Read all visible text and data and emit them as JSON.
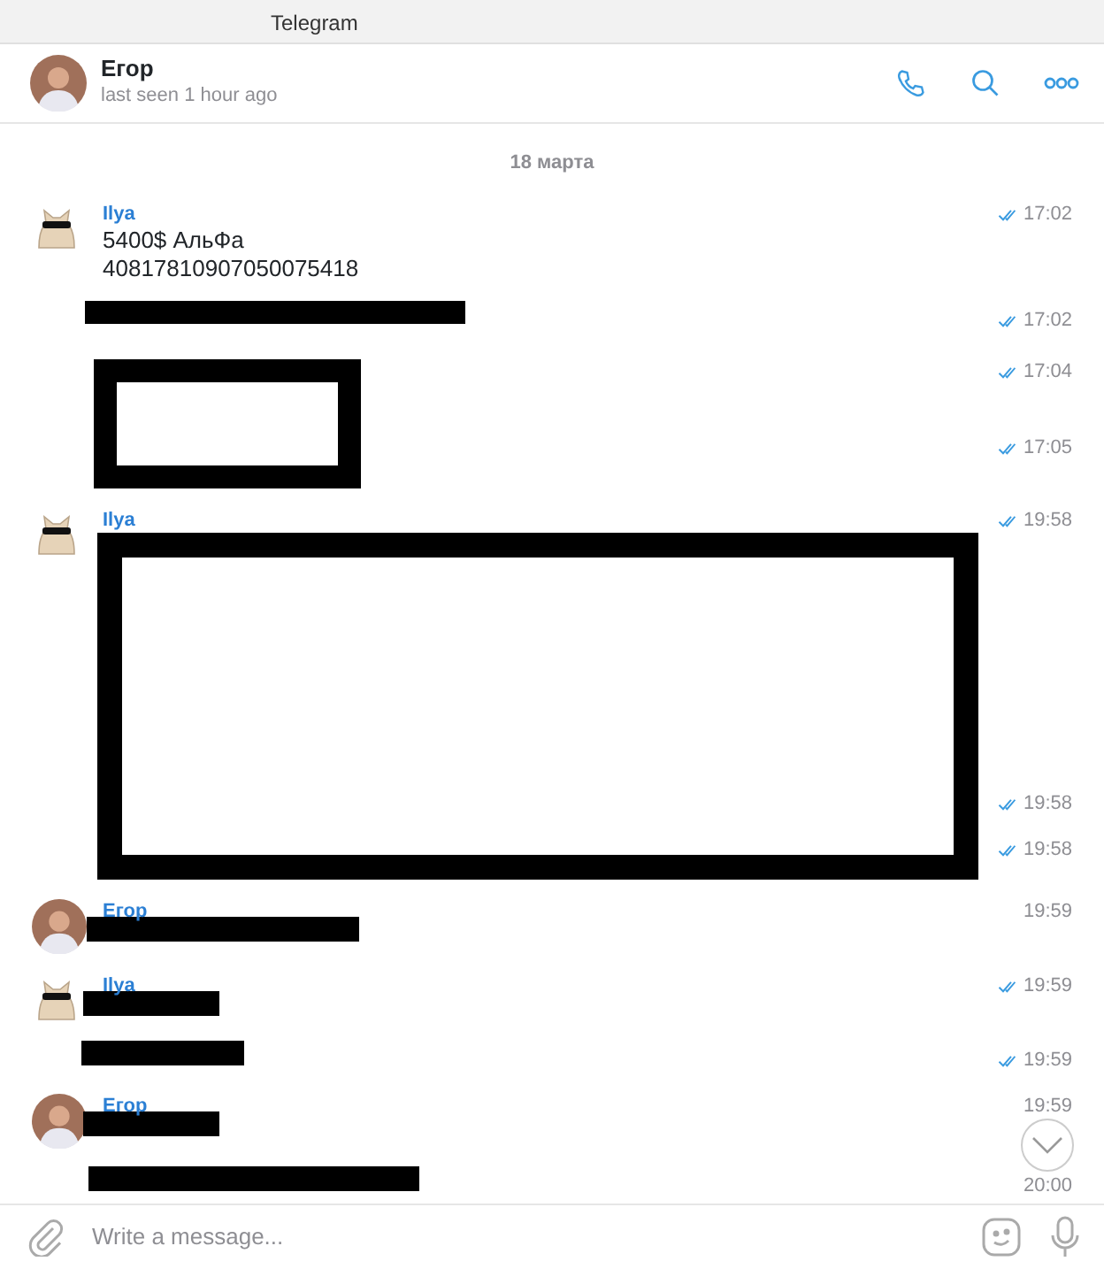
{
  "window": {
    "title": "Telegram"
  },
  "chat": {
    "name": "Егор",
    "status": "last seen 1 hour ago"
  },
  "date": "18 марта",
  "messages": [
    {
      "sender": "Ilya",
      "avatar": {
        "kind": "sticker"
      },
      "lines": [
        "5400$ АльФа",
        "40817810907050075418"
      ],
      "stamps": [
        {
          "time": "17:02",
          "read": true
        }
      ]
    },
    {
      "redaction": {
        "kind": "long"
      },
      "stamps": [
        {
          "time": "17:02",
          "read": true
        }
      ]
    },
    {
      "redaction": {
        "kind": "frame"
      },
      "stamps": [
        {
          "time": "17:04",
          "read": true
        },
        {
          "time": "17:05",
          "read": true
        }
      ]
    },
    {
      "sender": "Ilya",
      "avatar": {
        "kind": "sticker"
      },
      "stamps": [
        {
          "time": "19:58",
          "read": true
        }
      ]
    },
    {
      "redaction": {
        "kind": "bigframe"
      },
      "stamps": [
        {
          "time": "19:58",
          "read": true
        },
        {
          "time": "19:58",
          "read": true
        }
      ]
    },
    {
      "sender": "Егор",
      "avatar": {
        "kind": "photo"
      },
      "redaction": {
        "kind": "medium"
      },
      "stamps": [
        {
          "time": "19:59",
          "read": false
        }
      ]
    },
    {
      "sender": "Ilya",
      "avatar": {
        "kind": "sticker"
      },
      "redaction": {
        "kind": "short"
      },
      "stamps": [
        {
          "time": "19:59",
          "read": true
        }
      ]
    },
    {
      "redaction": {
        "kind": "small"
      },
      "stamps": [
        {
          "time": "19:59",
          "read": true
        }
      ]
    },
    {
      "sender": "Егор",
      "avatar": {
        "kind": "photo"
      },
      "redaction": {
        "kind": "short"
      },
      "stamps": [
        {
          "time": "19:59",
          "read": false
        }
      ]
    },
    {
      "redaction": {
        "kind": "wide"
      },
      "stamps": [
        {
          "time": "20:00",
          "read": false
        }
      ]
    }
  ],
  "composer": {
    "placeholder": "Write a message..."
  }
}
